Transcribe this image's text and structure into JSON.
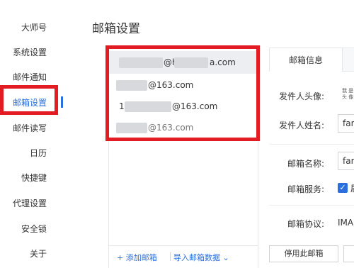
{
  "sidebar": {
    "items": [
      {
        "label": "大师号"
      },
      {
        "label": "系统设置"
      },
      {
        "label": "邮件通知"
      },
      {
        "label": "邮箱设置"
      },
      {
        "label": "邮件读写"
      },
      {
        "label": "日历"
      },
      {
        "label": "快捷键"
      },
      {
        "label": "代理设置"
      },
      {
        "label": "安全锁"
      },
      {
        "label": "关于"
      }
    ],
    "active_index": 3
  },
  "page": {
    "title": "邮箱设置"
  },
  "accounts": [
    {
      "visible_text": "@h",
      "visible_suffix": "a.com",
      "selected": true
    },
    {
      "visible_text": "@163.com",
      "selected": false
    },
    {
      "visible_text": "@163.com",
      "selected": false,
      "prefix": "1"
    },
    {
      "visible_text": "@163.com",
      "selected": false,
      "muted": true
    }
  ],
  "list_footer": {
    "add_label": "+ 添加邮箱",
    "import_label": "导入邮箱数据 ⌄"
  },
  "detail": {
    "tab_label": "邮箱信息",
    "avatar_label": "发件人头像:",
    "avatar_note": "我 是 头 像",
    "name_label": "发件人姓名:",
    "name_value": "fan",
    "mailbox_name_label": "邮箱名称:",
    "mailbox_name_value": "fan",
    "service_label": "邮箱服务:",
    "service_check_text": "届",
    "protocol_label": "邮箱协议:",
    "protocol_value": "IMAI",
    "stop_button": "停用此邮箱"
  },
  "colors": {
    "accent": "#2a6fdb",
    "highlight": "#e31c23"
  }
}
